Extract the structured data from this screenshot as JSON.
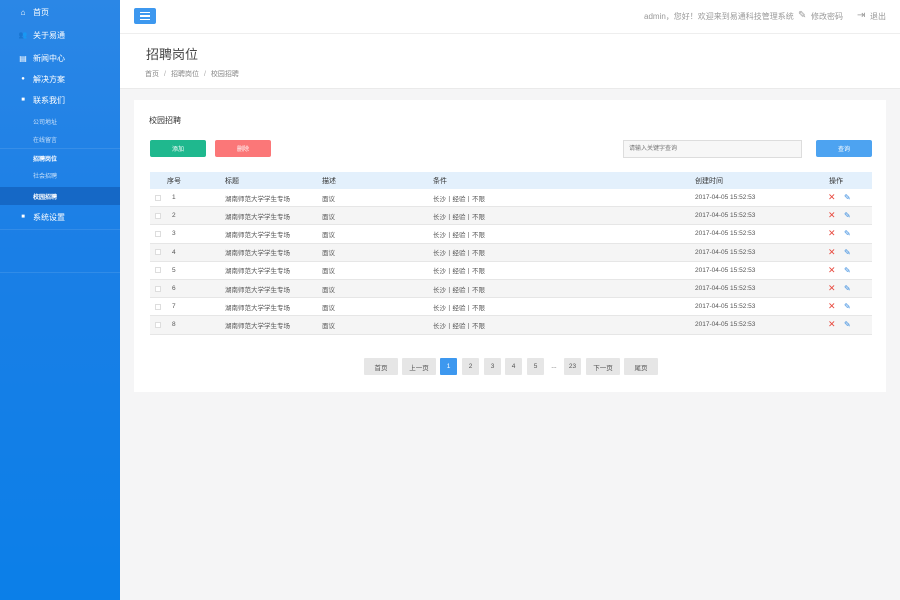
{
  "sidebar": {
    "items": [
      {
        "label": "首页",
        "icon": "home-icon",
        "glyph": "⌂"
      },
      {
        "label": "关于易通",
        "icon": "users-icon",
        "glyph": "👥"
      },
      {
        "label": "新闻中心",
        "icon": "newspaper-icon",
        "glyph": "▤"
      },
      {
        "label": "解决方案",
        "icon": "map-pin-icon",
        "glyph": "●"
      },
      {
        "label": "联系我们",
        "icon": "chat-icon",
        "glyph": "■"
      }
    ],
    "sub_items": [
      {
        "label": "公司地址"
      },
      {
        "label": "在线留言"
      },
      {
        "label": "招聘岗位"
      },
      {
        "label": "社会招聘"
      },
      {
        "label": "校园招聘"
      }
    ],
    "settings": {
      "label": "系统设置",
      "icon": "chat-icon",
      "glyph": "■"
    }
  },
  "header": {
    "welcome": "admin，您好！欢迎来到易通科技管理系统",
    "change_password": "修改密码",
    "logout": "退出"
  },
  "page": {
    "title": "招聘岗位",
    "breadcrumb": [
      "首页",
      "招聘岗位",
      "校园招聘"
    ]
  },
  "panel": {
    "title": "校园招聘",
    "add_label": "添加",
    "delete_label": "删除",
    "search_placeholder": "请输入关键字查询",
    "search_label": "查询"
  },
  "table": {
    "columns": [
      "序号",
      "标题",
      "描述",
      "条件",
      "创建时间",
      "操作"
    ],
    "rows": [
      {
        "no": "1",
        "title": "湖南师范大学学生专场",
        "desc": "面议",
        "cond": "长沙丨经验丨不限",
        "time": "2017-04-05 15:52:53"
      },
      {
        "no": "2",
        "title": "湖南师范大学学生专场",
        "desc": "面议",
        "cond": "长沙丨经验丨不限",
        "time": "2017-04-05 15:52:53"
      },
      {
        "no": "3",
        "title": "湖南师范大学学生专场",
        "desc": "面议",
        "cond": "长沙丨经验丨不限",
        "time": "2017-04-05 15:52:53"
      },
      {
        "no": "4",
        "title": "湖南师范大学学生专场",
        "desc": "面议",
        "cond": "长沙丨经验丨不限",
        "time": "2017-04-05 15:52:53"
      },
      {
        "no": "5",
        "title": "湖南师范大学学生专场",
        "desc": "面议",
        "cond": "长沙丨经验丨不限",
        "time": "2017-04-05 15:52:53"
      },
      {
        "no": "6",
        "title": "湖南师范大学学生专场",
        "desc": "面议",
        "cond": "长沙丨经验丨不限",
        "time": "2017-04-05 15:52:53"
      },
      {
        "no": "7",
        "title": "湖南师范大学学生专场",
        "desc": "面议",
        "cond": "长沙丨经验丨不限",
        "time": "2017-04-05 15:52:53"
      },
      {
        "no": "8",
        "title": "湖南师范大学学生专场",
        "desc": "面议",
        "cond": "长沙丨经验丨不限",
        "time": "2017-04-05 15:52:53"
      }
    ]
  },
  "pagination": {
    "first": "首页",
    "prev": "上一页",
    "pages": [
      "1",
      "2",
      "3",
      "4",
      "5"
    ],
    "ellipsis": "...",
    "last_page": "23",
    "next": "下一页",
    "last": "尾页",
    "current": "1"
  },
  "colors": {
    "sidebar": "#1b7fe6",
    "accent": "#3d98ef",
    "add": "#1fb88e",
    "delete": "#fb7778"
  }
}
